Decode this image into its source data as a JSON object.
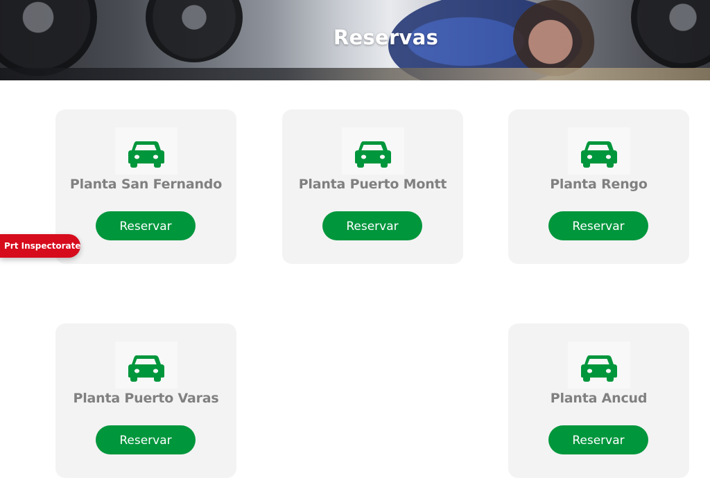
{
  "header": {
    "title": "Reservas"
  },
  "brand": {
    "accent": "#00963c",
    "tab_color": "#d60c1d"
  },
  "plants": [
    {
      "name": "Planta San Fernando",
      "button": "Reservar",
      "icon": "car-icon"
    },
    {
      "name": "Planta Puerto Montt",
      "button": "Reservar",
      "icon": "car-icon"
    },
    {
      "name": "Planta Rengo",
      "button": "Reservar",
      "icon": "car-icon"
    },
    {
      "name": "Planta Puerto Varas",
      "button": "Reservar",
      "icon": "car-icon"
    },
    {
      "name": "Planta Ancud",
      "button": "Reservar",
      "icon": "car-icon"
    }
  ],
  "side_tab": {
    "label": "Prt Inspectorate"
  }
}
